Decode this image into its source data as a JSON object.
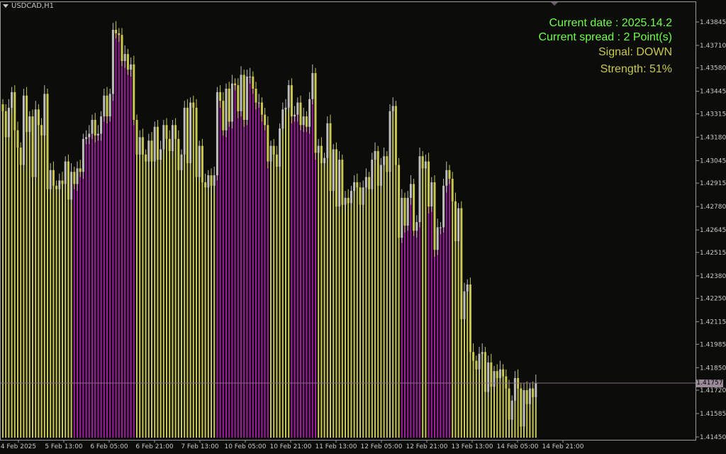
{
  "window": {
    "symbol_label": "USDCAD,H1"
  },
  "indicator": {
    "current_date": "Current date : 2025.14.2",
    "current_spread": "Current spread : 2 Point(s)",
    "signal": "Signal: DOWN",
    "strength": "Strength: 51%"
  },
  "colors": {
    "background": "#0c0c0a",
    "frame": "#9a9a9a",
    "up_candle": "#bdbdbd",
    "down_candle": "#c8c850",
    "bar_fill_normal": "#c8c850",
    "bar_fill_highlight": "#a01aa0",
    "info_green": "#6fff4a",
    "info_yellow": "#c8c850",
    "bid_line": "#8a6a8a",
    "price_label_bg": "#9a8a9a"
  },
  "price_axis": {
    "ticks": [
      "1.43845",
      "1.43710",
      "1.43580",
      "1.43445",
      "1.43315",
      "1.43180",
      "1.43045",
      "1.42915",
      "1.42780",
      "1.42645",
      "1.42515",
      "1.42380",
      "1.42250",
      "1.42115",
      "1.41985",
      "1.41850",
      "1.41720",
      "1.41585",
      "1.41450"
    ],
    "current_price": "1.41757"
  },
  "time_axis": {
    "labels": [
      "4 Feb 2025",
      "5 Feb 13:00",
      "6 Feb 05:00",
      "6 Feb 21:00",
      "7 Feb 13:00",
      "10 Feb 05:00",
      "10 Feb 21:00",
      "11 Feb 13:00",
      "12 Feb 05:00",
      "12 Feb 21:00",
      "13 Feb 13:00",
      "14 Feb 05:00",
      "14 Feb 21:00"
    ]
  },
  "chart_data": {
    "type": "candlestick",
    "symbol": "USDCAD",
    "timeframe": "H1",
    "ylim": [
      1.4145,
      1.4389
    ],
    "close": [
      1.4333,
      1.4318,
      1.4335,
      1.4344,
      1.4322,
      1.4312,
      1.4302,
      1.4342,
      1.4321,
      1.433,
      1.4295,
      1.4334,
      1.4325,
      1.4319,
      1.4343,
      1.4288,
      1.4299,
      1.429,
      1.4288,
      1.4293,
      1.4291,
      1.4304,
      1.4282,
      1.4298,
      1.4291,
      1.43,
      1.4298,
      1.4317,
      1.4318,
      1.432,
      1.4328,
      1.4319,
      1.432,
      1.433,
      1.4342,
      1.433,
      1.4343,
      1.438,
      1.4378,
      1.4377,
      1.4362,
      1.4366,
      1.4357,
      1.436,
      1.4328,
      1.4308,
      1.4318,
      1.4308,
      1.4304,
      1.4316,
      1.4304,
      1.4324,
      1.4305,
      1.4311,
      1.4325,
      1.4317,
      1.431,
      1.4325,
      1.4317,
      1.4299,
      1.4308,
      1.4335,
      1.4303,
      1.4338,
      1.4335,
      1.4295,
      1.4313,
      1.4292,
      1.4289,
      1.4296,
      1.429,
      1.4296,
      1.4344,
      1.4339,
      1.4322,
      1.4346,
      1.4327,
      1.4349,
      1.4348,
      1.4333,
      1.4354,
      1.4328,
      1.4353,
      1.4353,
      1.4346,
      1.4338,
      1.4338,
      1.4331,
      1.4325,
      1.4304,
      1.4313,
      1.4308,
      1.4301,
      1.4323,
      1.4334,
      1.4335,
      1.4348,
      1.433,
      1.4331,
      1.4338,
      1.4325,
      1.433,
      1.4324,
      1.434,
      1.4355,
      1.4309,
      1.4313,
      1.4303,
      1.4306,
      1.4326,
      1.4287,
      1.4311,
      1.4278,
      1.4305,
      1.4279,
      1.4283,
      1.428,
      1.4287,
      1.4292,
      1.4289,
      1.4279,
      1.4289,
      1.4295,
      1.4288,
      1.4305,
      1.431,
      1.429,
      1.4302,
      1.4307,
      1.4298,
      1.4333,
      1.4336,
      1.4302,
      1.426,
      1.4283,
      1.4267,
      1.4283,
      1.4291,
      1.4264,
      1.4269,
      1.4307,
      1.43,
      1.4304,
      1.4278,
      1.4292,
      1.4253,
      1.4266,
      1.4266,
      1.429,
      1.4299,
      1.4294,
      1.4281,
      1.4258,
      1.4277,
      1.4213,
      1.4229,
      1.4233,
      1.4194,
      1.4189,
      1.4184,
      1.4193,
      1.4194,
      1.4171,
      1.4188,
      1.4174,
      1.4183,
      1.4179,
      1.4184,
      1.418,
      1.4173,
      1.4155,
      1.4166,
      1.4179,
      1.4173,
      1.4151,
      1.4172,
      1.4164,
      1.4173,
      1.4168,
      1.4176
    ]
  }
}
